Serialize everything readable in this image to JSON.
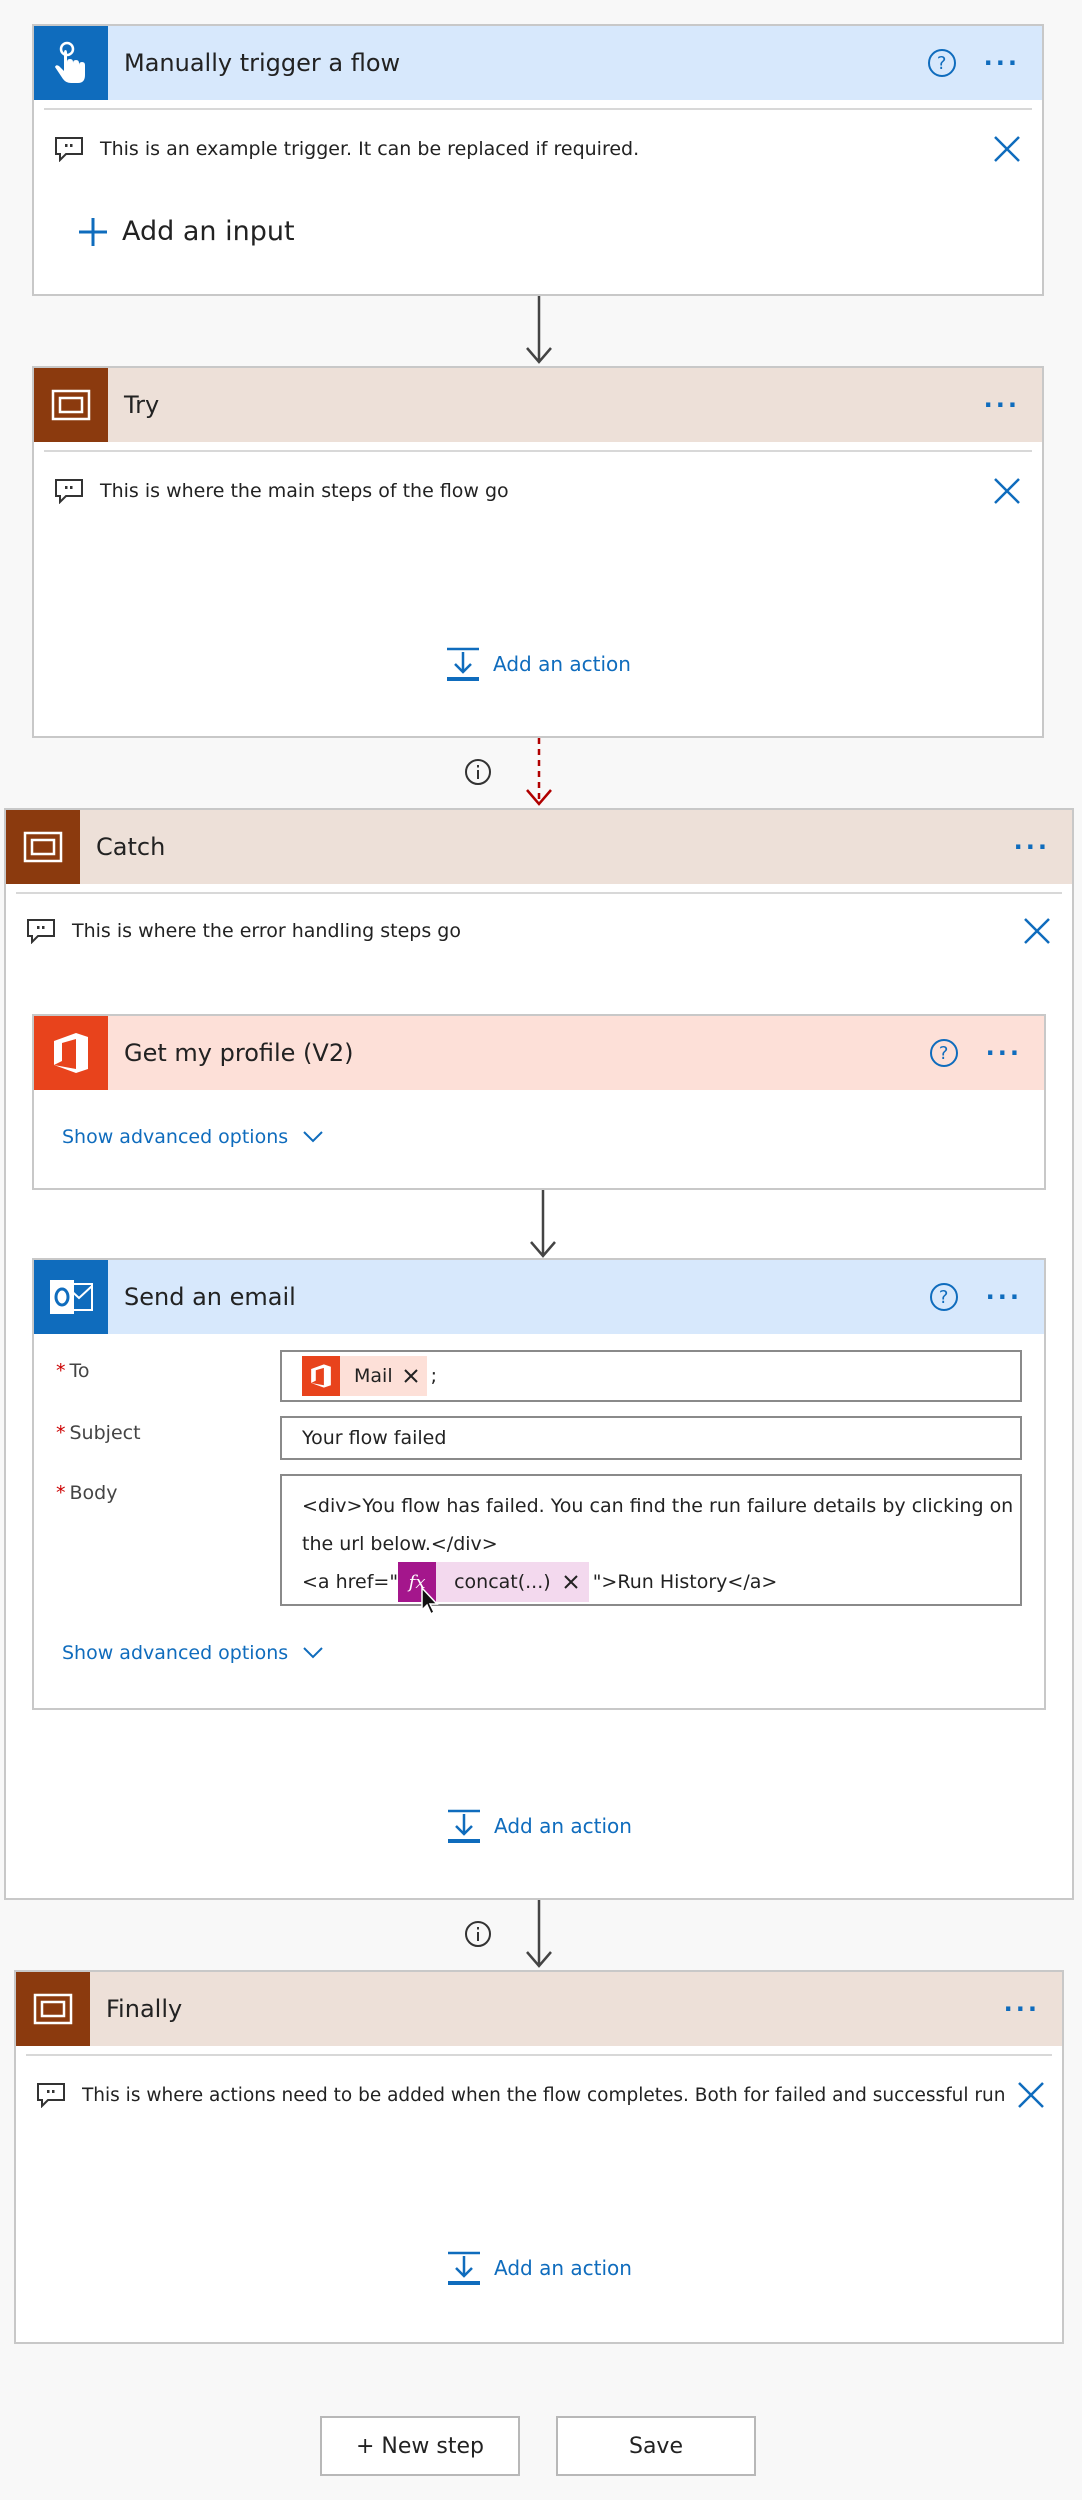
{
  "trigger": {
    "title": "Manually trigger a flow",
    "comment": "This is an example trigger. It can be replaced if required.",
    "add_input_label": "Add an input",
    "color": "#d7e8fc",
    "icon_color": "#0f6cbd"
  },
  "try_scope": {
    "title": "Try",
    "comment": "This is where the main steps of the flow go",
    "add_action_label": "Add an action"
  },
  "catch_scope": {
    "title": "Catch",
    "comment": "This is where the error handling steps go",
    "add_action_label": "Add an action"
  },
  "get_profile": {
    "title": "Get my profile (V2)",
    "advanced_label": "Show advanced options"
  },
  "send_email": {
    "title": "Send an email",
    "to_label": "To",
    "to_token": "Mail",
    "to_suffix": ";",
    "subject_label": "Subject",
    "subject_value": "Your flow failed",
    "body_label": "Body",
    "body_line1": "<div>You flow has failed. You can find the run failure details by clicking on",
    "body_line2": "the url below.</div>",
    "body_line3_prefix": "<a href=\"",
    "body_expr_token": "concat(...)",
    "body_line3_suffix": "\">Run History</a>",
    "fx_label": "fx",
    "advanced_label": "Show advanced options"
  },
  "finally_scope": {
    "title": "Finally",
    "comment": "This is where actions need to be added when the flow completes. Both for failed and successful runs.",
    "add_action_label": "Add an action"
  },
  "footer": {
    "new_step_label": "+ New step",
    "save_label": "Save"
  },
  "colors": {
    "scope_header": "#ede0d8",
    "scope_icon": "#8b3a0e",
    "office_header": "#fde0d8",
    "office_icon": "#e8431c",
    "outlook_icon": "#0f6cbd",
    "accent": "#0f6cbd",
    "run_after_arrow": "#b00000"
  }
}
